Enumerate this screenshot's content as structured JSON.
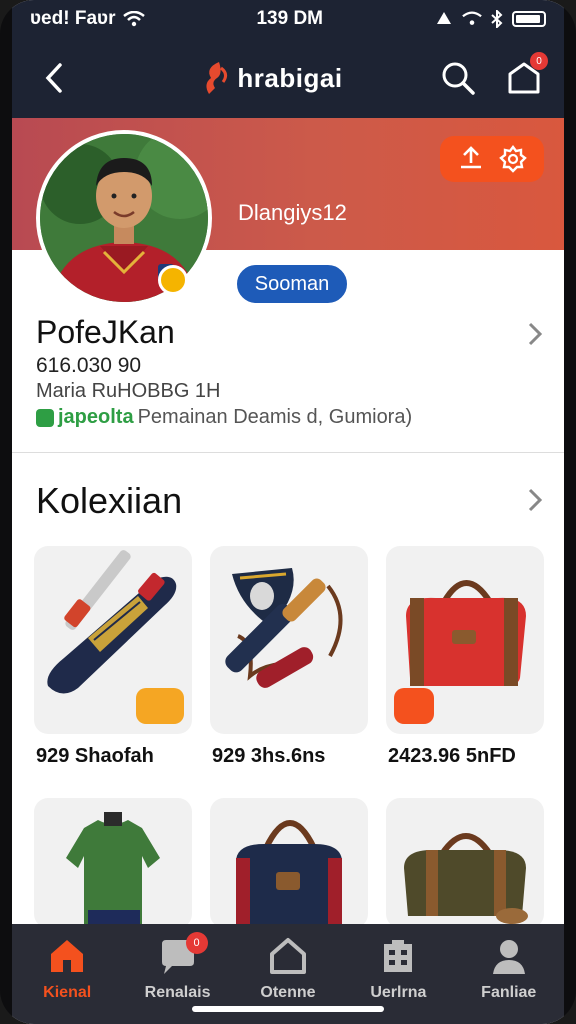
{
  "status_bar": {
    "carrier": "ʋed! Faʋr",
    "time": "139 DM"
  },
  "header": {
    "brand_name": "hrabigai",
    "icons": [
      "back-arrow-icon",
      "search-icon",
      "bag-icon"
    ],
    "bag_badge": "0"
  },
  "profile": {
    "handle": "Dlangiys12",
    "follow_label": "Sooman",
    "name": "PofeJKan",
    "stat": "616.030 90",
    "meta": "Maria RuHOBBG 1H",
    "desc_prefix": "japeolta",
    "desc": "Pemainan Deamis d,  Gumiora)",
    "accent": "#f4511e",
    "banner_color": "#c8524b"
  },
  "collection": {
    "title": "Kolexiian",
    "items": [
      {
        "price": "929 Shaofah",
        "icon": "cricket-bat-icon"
      },
      {
        "price": "929 3hs.6ns",
        "icon": "gear-set-icon"
      },
      {
        "price": "2423.96 5nFD",
        "icon": "duffel-bag-icon"
      },
      {
        "price": "",
        "icon": "jersey-icon"
      },
      {
        "price": "",
        "icon": "navy-bag-icon"
      },
      {
        "price": "",
        "icon": "olive-bag-icon"
      }
    ]
  },
  "tabs": [
    {
      "label": "Kienal",
      "icon": "home-icon",
      "active": true
    },
    {
      "label": "Renalais",
      "icon": "chat-icon",
      "badge": "0"
    },
    {
      "label": "Otenne",
      "icon": "house-icon"
    },
    {
      "label": "Uerlrna",
      "icon": "building-icon"
    },
    {
      "label": "Fanliae",
      "icon": "profile-icon"
    }
  ]
}
